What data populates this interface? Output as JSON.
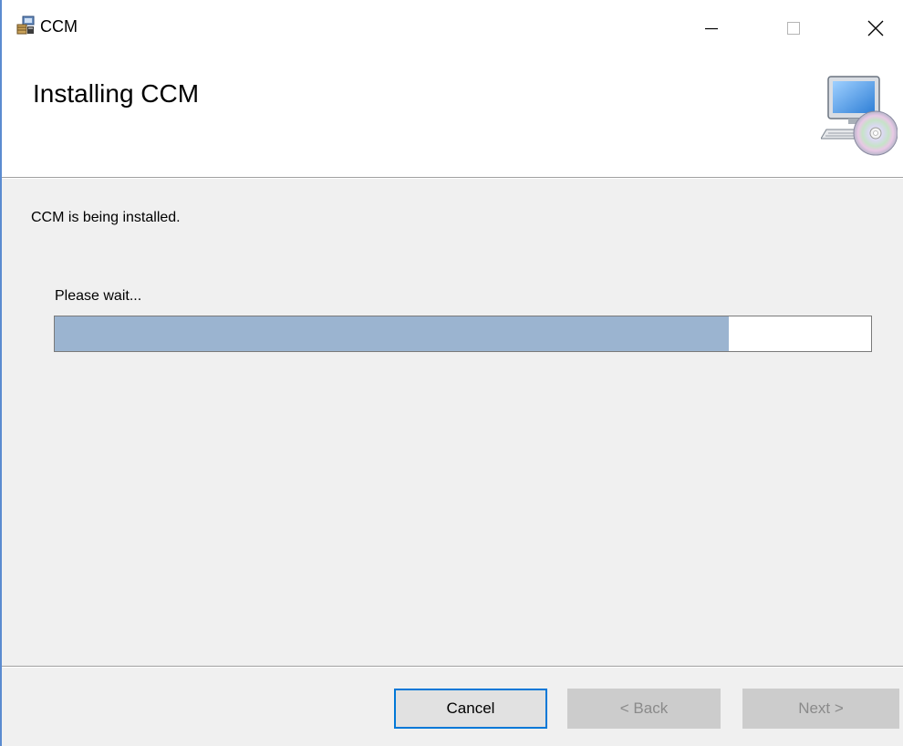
{
  "window": {
    "title": "CCM",
    "controls": {
      "minimize": "minimize",
      "maximize": "maximize",
      "close": "close"
    }
  },
  "header": {
    "title": "Installing CCM",
    "icon": "computer-cd-icon"
  },
  "body": {
    "status": "CCM is being installed.",
    "wait_label": "Please wait...",
    "progress_fraction": 0.826,
    "progress_fill_color": "#9bb4d0"
  },
  "footer": {
    "cancel_label": "Cancel",
    "back_label": "< Back",
    "next_label": "Next >"
  },
  "colors": {
    "accent": "#0078d7",
    "window_border": "#5b8bd0"
  }
}
